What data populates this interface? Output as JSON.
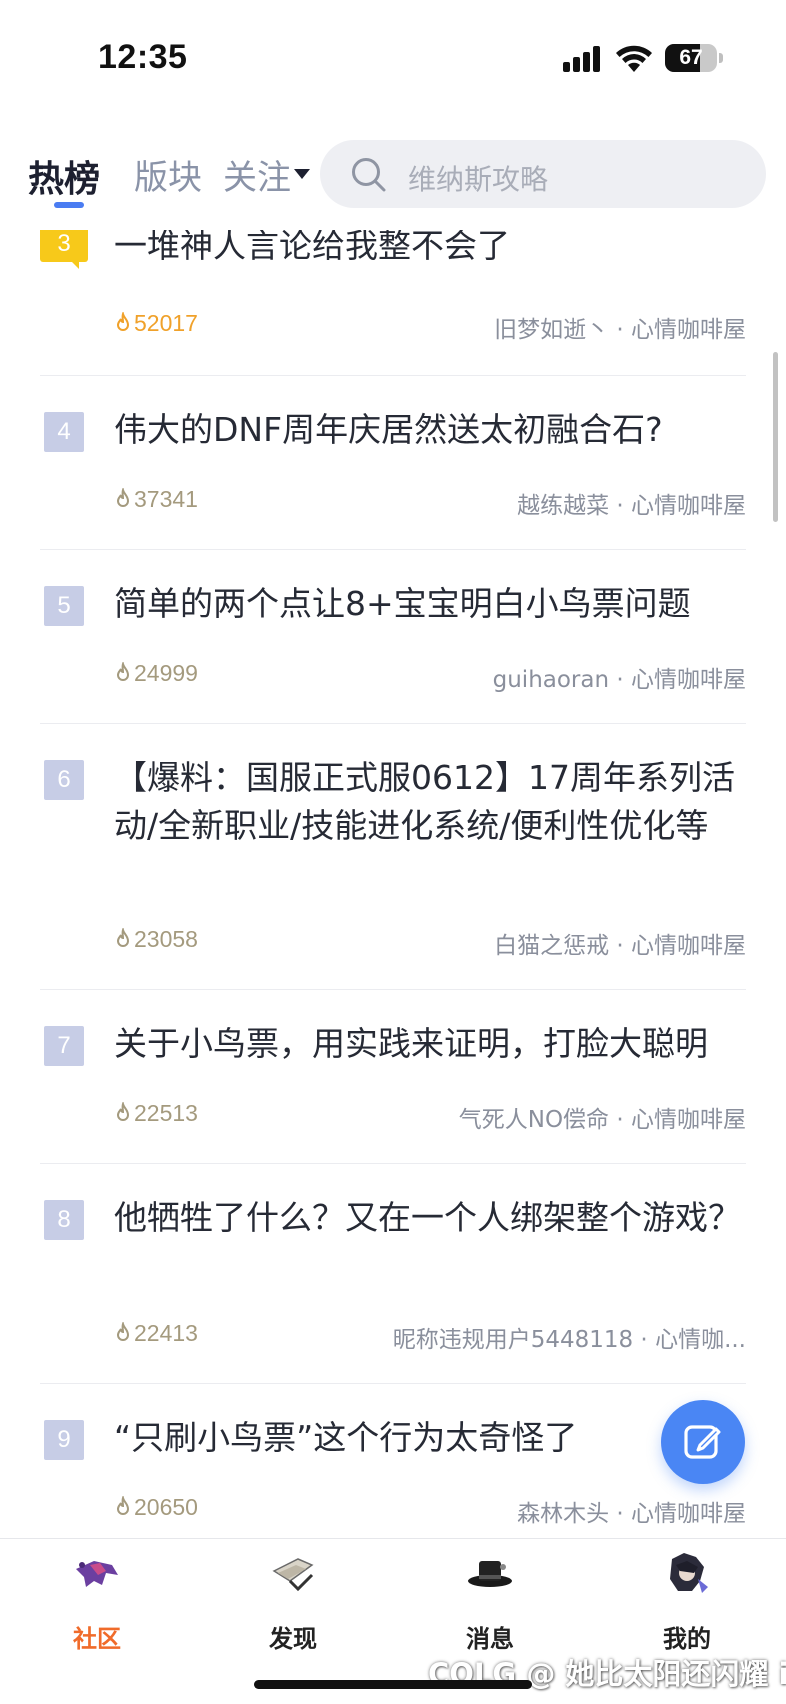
{
  "status_bar": {
    "time": "12:35",
    "battery": "67",
    "battery_level": 0.67
  },
  "top_nav": {
    "tabs": [
      "热榜",
      "版块",
      "关注"
    ],
    "search_placeholder": "维纳斯攻略"
  },
  "feed": [
    {
      "rank": "3",
      "title": "一堆神人言论给我整不会了",
      "heat": "52017",
      "author": "旧梦如逝丶",
      "board": "心情咖啡屋",
      "hot": true
    },
    {
      "rank": "4",
      "title": "伟大的DNF周年庆居然送太初融合石?",
      "heat": "37341",
      "author": "越练越菜",
      "board": "心情咖啡屋",
      "hot": false
    },
    {
      "rank": "5",
      "title": "简单的两个点让8+宝宝明白小鸟票问题",
      "heat": "24999",
      "author": "guihaoran",
      "board": "心情咖啡屋",
      "hot": false
    },
    {
      "rank": "6",
      "title": "【爆料：国服正式服0612】17周年系列活动/全新职业/技能进化系统/便利性优化等",
      "heat": "23058",
      "author": "白猫之惩戒",
      "board": "心情咖啡屋",
      "hot": false
    },
    {
      "rank": "7",
      "title": "关于小鸟票，用实践来证明，打脸大聪明",
      "heat": "22513",
      "author": "气死人NO偿命",
      "board": "心情咖啡屋",
      "hot": false
    },
    {
      "rank": "8",
      "title": "他牺牲了什么？又在一个人绑架整个游戏？",
      "heat": "22413",
      "author": "昵称违规用户5448118",
      "board": "心情咖...",
      "hot": false
    },
    {
      "rank": "9",
      "title": "“只刷小鸟票”这个行为太奇怪了",
      "heat": "20650",
      "author": "森林木头",
      "board": "心情咖啡屋",
      "hot": false
    }
  ],
  "meta_separator": " · ",
  "tabbar": {
    "items": [
      {
        "label": "社区",
        "active": true
      },
      {
        "label": "发现",
        "active": false
      },
      {
        "label": "消息",
        "active": false
      },
      {
        "label": "我的",
        "active": false
      }
    ]
  },
  "watermark": "COLG @ 她比太阳还闪耀 i",
  "colors": {
    "accent": "#4a86f4",
    "active_tab": "#f06b2a",
    "top_rank": "#f7c91a",
    "rank": "#c7cde6",
    "hot_heat": "#f0a12a"
  }
}
